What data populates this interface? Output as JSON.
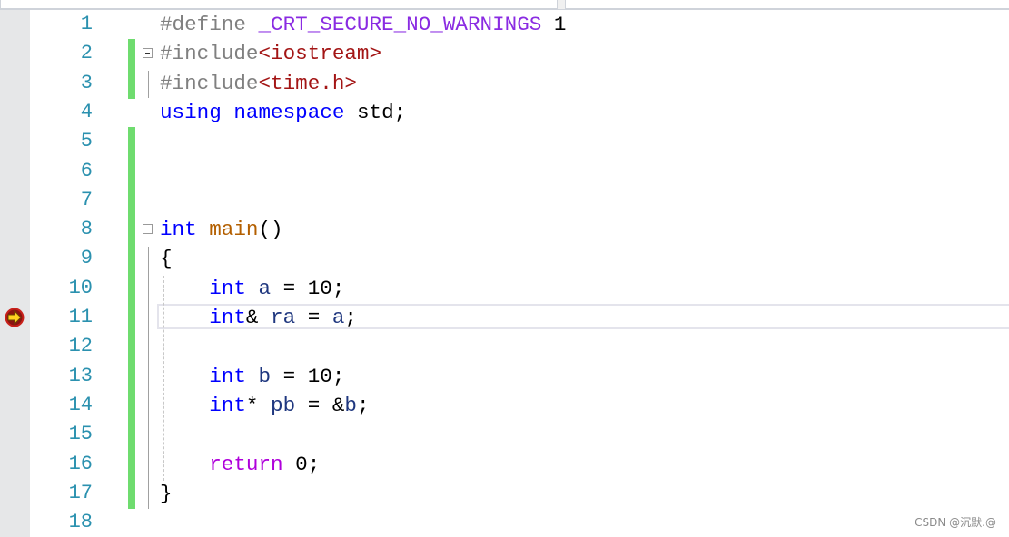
{
  "editor": {
    "current_line": 11,
    "changed_lines": [
      2,
      3,
      5,
      6,
      7,
      8,
      9,
      10,
      11,
      12,
      13,
      14,
      15,
      16,
      17
    ],
    "fold_lines": [
      2,
      8
    ],
    "lines": [
      {
        "n": "1",
        "tokens": [
          [
            "#define ",
            "pp"
          ],
          [
            "_CRT_SECURE_NO_WARNINGS",
            "mac"
          ],
          [
            " 1",
            "num"
          ]
        ]
      },
      {
        "n": "2",
        "tokens": [
          [
            "#include",
            "pp"
          ],
          [
            "<iostream>",
            "str"
          ]
        ]
      },
      {
        "n": "3",
        "tokens": [
          [
            "#include",
            "pp"
          ],
          [
            "<time.h>",
            "str"
          ]
        ]
      },
      {
        "n": "4",
        "tokens": [
          [
            "using",
            "kw"
          ],
          [
            " ",
            ""
          ],
          [
            "namespace",
            "kw"
          ],
          [
            " std;",
            ""
          ]
        ]
      },
      {
        "n": "5",
        "tokens": []
      },
      {
        "n": "6",
        "tokens": []
      },
      {
        "n": "7",
        "tokens": []
      },
      {
        "n": "8",
        "tokens": [
          [
            "int",
            "kw"
          ],
          [
            " ",
            ""
          ],
          [
            "main",
            "fn"
          ],
          [
            "()",
            ""
          ]
        ]
      },
      {
        "n": "9",
        "tokens": [
          [
            "{",
            ""
          ]
        ]
      },
      {
        "n": "10",
        "tokens": [
          [
            "    ",
            ""
          ],
          [
            "int",
            "kw"
          ],
          [
            " ",
            ""
          ],
          [
            "a",
            "var"
          ],
          [
            " = 10;",
            ""
          ]
        ]
      },
      {
        "n": "11",
        "tokens": [
          [
            "    ",
            ""
          ],
          [
            "int",
            "kw"
          ],
          [
            "& ",
            ""
          ],
          [
            "ra",
            "var"
          ],
          [
            " = ",
            ""
          ],
          [
            "a",
            "var"
          ],
          [
            ";",
            ""
          ]
        ]
      },
      {
        "n": "12",
        "tokens": []
      },
      {
        "n": "13",
        "tokens": [
          [
            "    ",
            ""
          ],
          [
            "int",
            "kw"
          ],
          [
            " ",
            ""
          ],
          [
            "b",
            "var"
          ],
          [
            " = 10;",
            ""
          ]
        ]
      },
      {
        "n": "14",
        "tokens": [
          [
            "    ",
            ""
          ],
          [
            "int",
            "kw"
          ],
          [
            "* ",
            ""
          ],
          [
            "pb",
            "var"
          ],
          [
            " = &",
            ""
          ],
          [
            "b",
            "var"
          ],
          [
            ";",
            ""
          ]
        ]
      },
      {
        "n": "15",
        "tokens": []
      },
      {
        "n": "16",
        "tokens": [
          [
            "    ",
            ""
          ],
          [
            "return",
            "ctl"
          ],
          [
            " 0;",
            ""
          ]
        ]
      },
      {
        "n": "17",
        "tokens": [
          [
            "}",
            ""
          ]
        ]
      },
      {
        "n": "18",
        "tokens": []
      }
    ]
  },
  "icons": {
    "current_statement": "yellow-arrow-icon",
    "fold": "collapse-minus-icon"
  },
  "watermark": "CSDN @沉默.@"
}
